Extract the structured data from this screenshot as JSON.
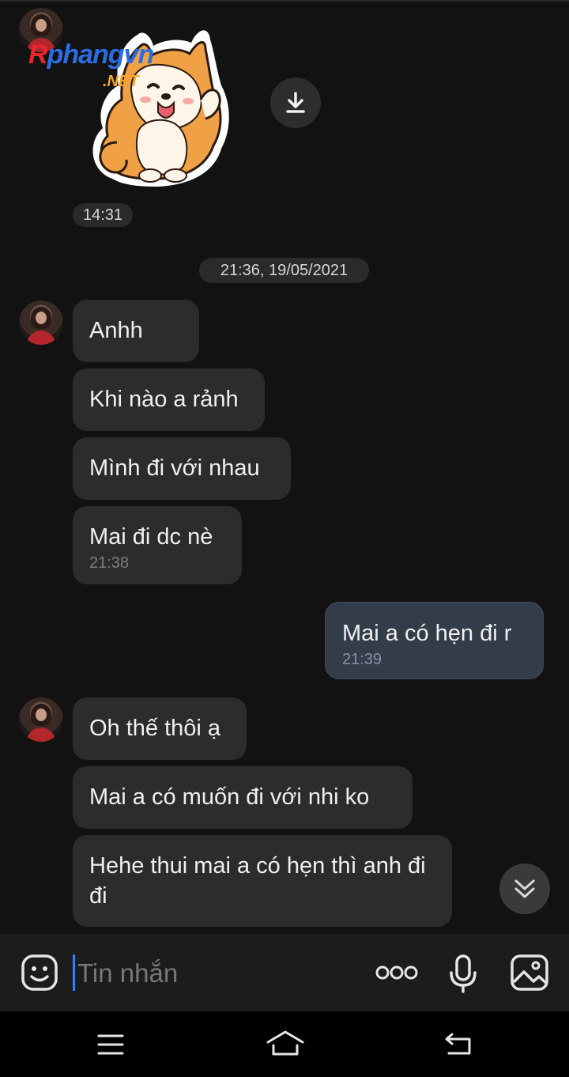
{
  "watermark": {
    "r": "R",
    "rest": "phangvn",
    "net": ".NET"
  },
  "sticker": {
    "time": "14:31"
  },
  "date_separator": "21:36, 19/05/2021",
  "messages": [
    {
      "from": "them",
      "text": "Anhh"
    },
    {
      "from": "them",
      "text": "Khi nào a rảnh"
    },
    {
      "from": "them",
      "text": "Mình đi với nhau"
    },
    {
      "from": "them",
      "text": "Mai đi dc nè",
      "time": "21:38"
    },
    {
      "from": "me",
      "text": "Mai a có hẹn đi r",
      "time": "21:39"
    },
    {
      "from": "them",
      "text": "Oh thế thôi ạ"
    },
    {
      "from": "them",
      "text": "Mai a có muốn đi với nhi ko"
    },
    {
      "from": "them",
      "text": "Hehe thui mai a có hẹn thì anh đi đi"
    }
  ],
  "composer": {
    "placeholder": "Tin nhắn"
  },
  "icons": {
    "download": "download-icon",
    "scroll_down": "chevron-double-down-icon",
    "emoji": "emoji-icon",
    "more": "more-icon",
    "mic": "microphone-icon",
    "image": "image-icon",
    "menu": "menu-icon",
    "home": "home-icon",
    "back": "back-icon"
  },
  "colors": {
    "background": "#121212",
    "bubble_them": "#2c2c2c",
    "bubble_me": "#333c49",
    "caret": "#2b83ff"
  }
}
